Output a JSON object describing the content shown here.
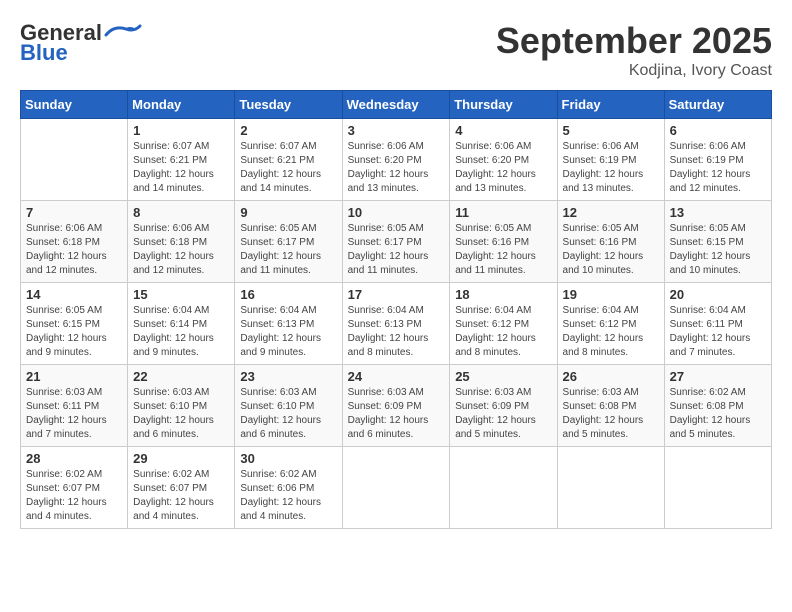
{
  "header": {
    "logo_general": "General",
    "logo_blue": "Blue",
    "month": "September 2025",
    "location": "Kodjina, Ivory Coast"
  },
  "weekdays": [
    "Sunday",
    "Monday",
    "Tuesday",
    "Wednesday",
    "Thursday",
    "Friday",
    "Saturday"
  ],
  "weeks": [
    [
      {
        "day": "",
        "info": ""
      },
      {
        "day": "1",
        "info": "Sunrise: 6:07 AM\nSunset: 6:21 PM\nDaylight: 12 hours\nand 14 minutes."
      },
      {
        "day": "2",
        "info": "Sunrise: 6:07 AM\nSunset: 6:21 PM\nDaylight: 12 hours\nand 14 minutes."
      },
      {
        "day": "3",
        "info": "Sunrise: 6:06 AM\nSunset: 6:20 PM\nDaylight: 12 hours\nand 13 minutes."
      },
      {
        "day": "4",
        "info": "Sunrise: 6:06 AM\nSunset: 6:20 PM\nDaylight: 12 hours\nand 13 minutes."
      },
      {
        "day": "5",
        "info": "Sunrise: 6:06 AM\nSunset: 6:19 PM\nDaylight: 12 hours\nand 13 minutes."
      },
      {
        "day": "6",
        "info": "Sunrise: 6:06 AM\nSunset: 6:19 PM\nDaylight: 12 hours\nand 12 minutes."
      }
    ],
    [
      {
        "day": "7",
        "info": "Sunrise: 6:06 AM\nSunset: 6:18 PM\nDaylight: 12 hours\nand 12 minutes."
      },
      {
        "day": "8",
        "info": "Sunrise: 6:06 AM\nSunset: 6:18 PM\nDaylight: 12 hours\nand 12 minutes."
      },
      {
        "day": "9",
        "info": "Sunrise: 6:05 AM\nSunset: 6:17 PM\nDaylight: 12 hours\nand 11 minutes."
      },
      {
        "day": "10",
        "info": "Sunrise: 6:05 AM\nSunset: 6:17 PM\nDaylight: 12 hours\nand 11 minutes."
      },
      {
        "day": "11",
        "info": "Sunrise: 6:05 AM\nSunset: 6:16 PM\nDaylight: 12 hours\nand 11 minutes."
      },
      {
        "day": "12",
        "info": "Sunrise: 6:05 AM\nSunset: 6:16 PM\nDaylight: 12 hours\nand 10 minutes."
      },
      {
        "day": "13",
        "info": "Sunrise: 6:05 AM\nSunset: 6:15 PM\nDaylight: 12 hours\nand 10 minutes."
      }
    ],
    [
      {
        "day": "14",
        "info": "Sunrise: 6:05 AM\nSunset: 6:15 PM\nDaylight: 12 hours\nand 9 minutes."
      },
      {
        "day": "15",
        "info": "Sunrise: 6:04 AM\nSunset: 6:14 PM\nDaylight: 12 hours\nand 9 minutes."
      },
      {
        "day": "16",
        "info": "Sunrise: 6:04 AM\nSunset: 6:13 PM\nDaylight: 12 hours\nand 9 minutes."
      },
      {
        "day": "17",
        "info": "Sunrise: 6:04 AM\nSunset: 6:13 PM\nDaylight: 12 hours\nand 8 minutes."
      },
      {
        "day": "18",
        "info": "Sunrise: 6:04 AM\nSunset: 6:12 PM\nDaylight: 12 hours\nand 8 minutes."
      },
      {
        "day": "19",
        "info": "Sunrise: 6:04 AM\nSunset: 6:12 PM\nDaylight: 12 hours\nand 8 minutes."
      },
      {
        "day": "20",
        "info": "Sunrise: 6:04 AM\nSunset: 6:11 PM\nDaylight: 12 hours\nand 7 minutes."
      }
    ],
    [
      {
        "day": "21",
        "info": "Sunrise: 6:03 AM\nSunset: 6:11 PM\nDaylight: 12 hours\nand 7 minutes."
      },
      {
        "day": "22",
        "info": "Sunrise: 6:03 AM\nSunset: 6:10 PM\nDaylight: 12 hours\nand 6 minutes."
      },
      {
        "day": "23",
        "info": "Sunrise: 6:03 AM\nSunset: 6:10 PM\nDaylight: 12 hours\nand 6 minutes."
      },
      {
        "day": "24",
        "info": "Sunrise: 6:03 AM\nSunset: 6:09 PM\nDaylight: 12 hours\nand 6 minutes."
      },
      {
        "day": "25",
        "info": "Sunrise: 6:03 AM\nSunset: 6:09 PM\nDaylight: 12 hours\nand 5 minutes."
      },
      {
        "day": "26",
        "info": "Sunrise: 6:03 AM\nSunset: 6:08 PM\nDaylight: 12 hours\nand 5 minutes."
      },
      {
        "day": "27",
        "info": "Sunrise: 6:02 AM\nSunset: 6:08 PM\nDaylight: 12 hours\nand 5 minutes."
      }
    ],
    [
      {
        "day": "28",
        "info": "Sunrise: 6:02 AM\nSunset: 6:07 PM\nDaylight: 12 hours\nand 4 minutes."
      },
      {
        "day": "29",
        "info": "Sunrise: 6:02 AM\nSunset: 6:07 PM\nDaylight: 12 hours\nand 4 minutes."
      },
      {
        "day": "30",
        "info": "Sunrise: 6:02 AM\nSunset: 6:06 PM\nDaylight: 12 hours\nand 4 minutes."
      },
      {
        "day": "",
        "info": ""
      },
      {
        "day": "",
        "info": ""
      },
      {
        "day": "",
        "info": ""
      },
      {
        "day": "",
        "info": ""
      }
    ]
  ]
}
